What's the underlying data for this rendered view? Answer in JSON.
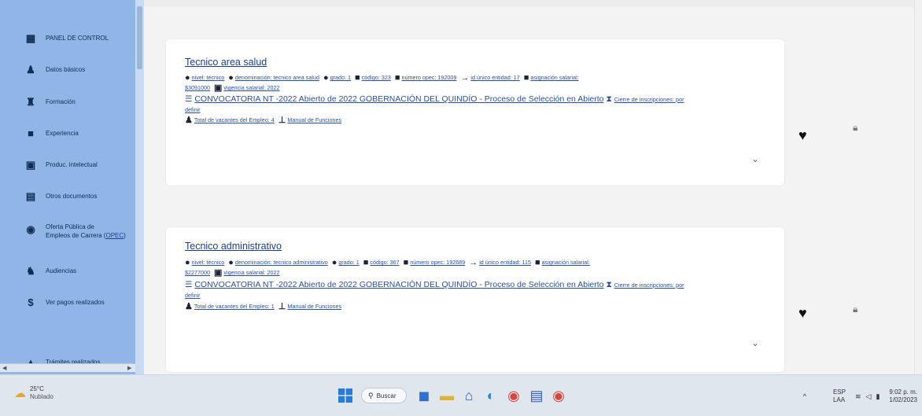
{
  "sidebar": {
    "items": [
      {
        "label": "PANEL DE CONTROL",
        "icon": "dashboard-icon",
        "glyph": "▦"
      },
      {
        "label": "Datos básicos",
        "icon": "users-icon",
        "glyph": "♟"
      },
      {
        "label": "Formación",
        "icon": "graduation-cap-icon",
        "glyph": "♜"
      },
      {
        "label": "Experiencia",
        "icon": "briefcase-icon",
        "glyph": "■"
      },
      {
        "label": "Produc. intelectual",
        "icon": "book-icon",
        "glyph": "▣"
      },
      {
        "label": "Otros documentos",
        "icon": "document-icon",
        "glyph": "▤"
      },
      {
        "label_line1": "Oferta Pública de",
        "label_line2_prefix": "Empleos de Carrera (",
        "label_line2_link": "OPEC",
        "label_line2_suffix": ")",
        "icon": "globe-icon",
        "glyph": "◉"
      },
      {
        "label": "Audiencias",
        "icon": "audience-icon",
        "glyph": "♞"
      },
      {
        "label": "Ver pagos realizados",
        "icon": "dollar-icon",
        "glyph": "$"
      },
      {
        "label": "Trámites realizados",
        "icon": "folder-icon",
        "glyph": "▲"
      }
    ]
  },
  "jobs": [
    {
      "title": "Tecnico area salud",
      "nivel": "nivel: técnico",
      "denominacion": "denominación: tecnico area salud",
      "grado": "grado: 1",
      "codigo": "código: 323",
      "numero_opec": "número opec: 192009",
      "id_entidad": "id único entidad: 17",
      "asignacion_label": "asignación salarial:",
      "asignacion_valor": "$3091000",
      "vigencia": "vigencia salarial: 2022",
      "convocatoria": "CONVOCATORIA NT -2022 Abierto de 2022 GOBERNACIÓN DEL QUINDÍO - Proceso de Selección en Abierto",
      "cierre_1": "Cierre de inscripciones: por",
      "cierre_2": "definir",
      "vacantes": "Total de vacantes del Empleo: 4",
      "manual": "Manual de Funciones"
    },
    {
      "title": "Tecnico administrativo",
      "nivel": "nivel: técnico",
      "denominacion": "denominación: tecnico administrativo",
      "grado": "grado: 1",
      "codigo": "código: 367",
      "numero_opec": "número opec: 192689",
      "id_entidad": "id único entidad: 115",
      "asignacion_label": "asignación salarial:",
      "asignacion_valor": "$2277000",
      "vigencia": "vigencia salarial: 2022",
      "convocatoria": "CONVOCATORIA NT -2022 Abierto de 2022 GOBERNACIÓN DEL QUINDÍO - Proceso de Selección en Abierto",
      "cierre_1": "Cierre de inscripciones: por",
      "cierre_2": "definir",
      "vacantes": "Total de vacantes del Empleo: 1",
      "manual": "Manual de Funciones"
    }
  ],
  "taskbar": {
    "weather_temp": "25°C",
    "weather_desc": "Nublado",
    "search_label": "Buscar",
    "lang_line1": "ESP",
    "lang_line2": "LAA",
    "time": "9:02 p. m.",
    "date": "1/02/2023"
  },
  "colors": {
    "sidebar_bg": "#8fb6e6",
    "link_blue": "#2e4f9c",
    "title_blue": "#1a3f8f",
    "taskbar_bg": "#dfe6ee"
  }
}
